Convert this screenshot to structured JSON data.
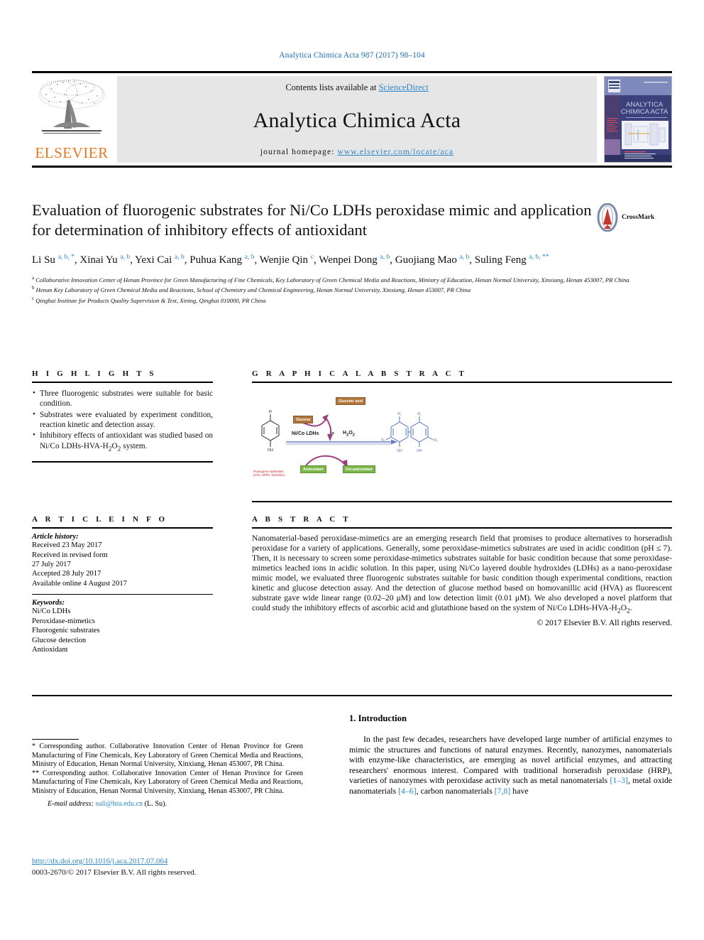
{
  "running_head": "Analytica Chimica Acta 987 (2017) 98–104",
  "masthead": {
    "contents_prefix": "Contents lists available at ",
    "sciencedirect": "ScienceDirect",
    "journal_name": "Analytica Chimica Acta",
    "homepage_label": "journal homepage:",
    "homepage_url": "www.elsevier.com/locate/aca",
    "publisher": "ELSEVIER",
    "cover_title_line1": "ANALYTICA",
    "cover_title_line2": "CHIMICA ACTA"
  },
  "article": {
    "title": "Evaluation of fluorogenic substrates for Ni/Co LDHs peroxidase mimic and application for determination of inhibitory effects of antioxidant",
    "crossmark_label": "CrossMark",
    "authors_html": "Li Su <sup>a, b, *</sup>, Xinai Yu <sup>a, b</sup>, Yexi Cai <sup>a, b</sup>, Puhua Kang <sup>a, b</sup>, Wenjie Qin <sup>c</sup>, Wenpei Dong <sup>a, b</sup>, Guojiang Mao <sup>a, b</sup>, Suling Feng <sup>a, b, **</sup>",
    "affiliations": [
      "a Collaborative Innovation Center of Henan Province for Green Manufacturing of Fine Chemicals, Key Laboratory of Green Chemical Media and Reactions, Ministry of Education, Henan Normal University, Xinxiang, Henan 453007, PR China",
      "b Henan Key Laboratory of Green Chemical Media and Reactions, School of Chemistry and Chemical Engineering, Henan Normal University, Xinxiang, Henan 453007, PR China",
      "c Qinghai Institute for Products Quality Supervision & Test, Xining, Qinghai 810000, PR China"
    ]
  },
  "highlights": {
    "heading": "H I G H L I G H T S",
    "items": [
      "Three fluorogenic substrates were suitable for basic condition.",
      "Substrates were evaluated by experiment condition, reaction kinetic and detection assay.",
      "Inhibitory effects of antioxidant was studied based on Ni/Co LDHs-HVA-H2O2 system."
    ]
  },
  "graphical_abstract": {
    "heading": "G R A P H I C A L   A B S T R A C T",
    "labels": {
      "gluconic_acid": "Gluconic acid",
      "glucose": "Glucose",
      "reaction": "Ni/Co LDHs",
      "plus": "+",
      "h2o2": "H2O2",
      "antioxidant": "Antioxidant",
      "oxi_antioxidant": "Oxi-antioxidant",
      "substrate_note_line1": "Fluorogenic substrates",
      "substrate_note_line2": "(HVA, HPPA, Tyramine)",
      "r1": "R1",
      "r2": "R2",
      "oh": "OH"
    }
  },
  "article_info": {
    "heading": "A R T I C L E   I N F O",
    "history_label": "Article history:",
    "history": [
      "Received 23 May 2017",
      "Received in revised form",
      "27 July 2017",
      "Accepted 28 July 2017",
      "Available online 4 August 2017"
    ],
    "keywords_label": "Keywords:",
    "keywords": [
      "Ni/Co LDHs",
      "Peroxidase-mimetics",
      "Fluorogenic substrates",
      "Glucose detection",
      "Antioxidant"
    ]
  },
  "abstract": {
    "heading": "A B S T R A C T",
    "text": "Nanomaterial-based peroxidase-mimetics are an emerging research field that promises to produce alternatives to horseradish peroxidase for a variety of applications. Generally, some peroxidase-mimetics substrates are used in acidic condition (pH ≤ 7). Then, it is necessary to screen some peroxidase-mimetics substrates suitable for basic condition because that some peroxidase-mimetics leached ions in acidic solution. In this paper, using Ni/Co layered double hydroxides (LDHs) as a nano-peroxidase mimic model, we evaluated three fluorogenic substrates suitable for basic condition though experimental conditions, reaction kinetic and glucose detection assay. And the detection of glucose method based on homovanillic acid (HVA) as fluorescent substrate gave wide linear range (0.02–20 μM) and low detection limit (0.01 μM). We also developed a novel platform that could study the inhibitory effects of ascorbic acid and glutathione based on the system of Ni/Co LDHs-HVA-H2O2.",
    "copyright": "© 2017 Elsevier B.V. All rights reserved."
  },
  "footnotes": {
    "corresponding_1": "* Corresponding author. Collaborative Innovation Center of Henan Province for Green Manufacturing of Fine Chemicals, Key Laboratory of Green Chemical Media and Reactions, Ministry of Education, Henan Normal University, Xinxiang, Henan 453007, PR China.",
    "corresponding_2": "** Corresponding author. Collaborative Innovation Center of Henan Province for Green Manufacturing of Fine Chemicals, Key Laboratory of Green Chemical Media and Reactions, Ministry of Education, Henan Normal University, Xinxiang, Henan 453007, PR China.",
    "email_label": "E-mail address:",
    "email": "suli@htu.edu.cn",
    "email_owner": "(L. Su)."
  },
  "doi": {
    "url": "http://dx.doi.org/10.1016/j.aca.2017.07.064",
    "issn_line": "0003-2670/© 2017 Elsevier B.V. All rights reserved."
  },
  "introduction": {
    "heading": "1. Introduction",
    "paragraph_parts": [
      "In the past few decades, researchers have developed large number of artificial enzymes to mimic the structures and functions of natural enzymes. Recently, nanozymes, nanomaterials with enzyme-like characteristics, are emerging as novel artificial enzymes, and attracting researchers' enormous interest. Compared with traditional horseradish peroxidase (HRP), varieties of nanozymes with peroxidase activity such as metal nanomaterials ",
      "[1–3]",
      ", metal oxide nanomaterials ",
      "[4–6]",
      ", carbon nanomaterials ",
      "[7,8]",
      " have"
    ]
  },
  "colors": {
    "link": "#2e87c8",
    "elsevier_orange": "#e87722",
    "masthead_gray": "#e6e6e6"
  }
}
